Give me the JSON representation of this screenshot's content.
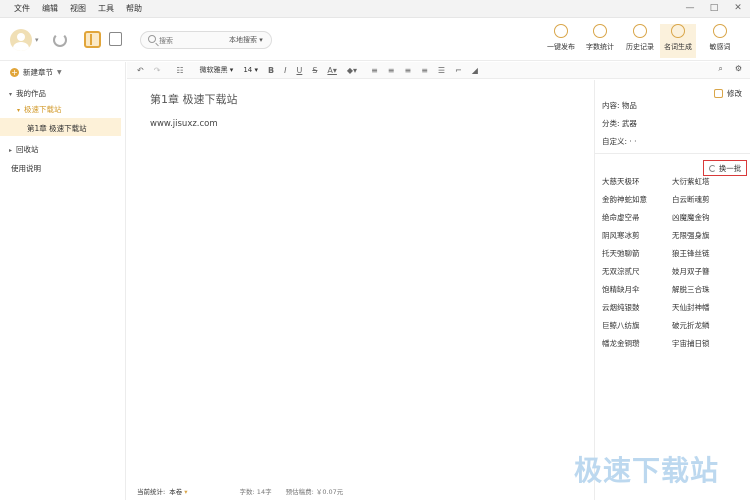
{
  "menu": [
    "文件",
    "编辑",
    "视图",
    "工具",
    "帮助"
  ],
  "window_controls": [
    "—",
    "□",
    "✕"
  ],
  "search": {
    "placeholder": "搜索",
    "scope": "本地搜索"
  },
  "toolbar": {
    "buttons": [
      {
        "label": "一键发布",
        "icon": "paper-plane-icon"
      },
      {
        "label": "字数统计",
        "icon": "stats-icon"
      },
      {
        "label": "历史记录",
        "icon": "history-icon"
      },
      {
        "label": "名词生成",
        "icon": "name-generator-icon",
        "active": true
      },
      {
        "label": "敏感词",
        "icon": "sensitive-word-icon"
      }
    ]
  },
  "sidebar": {
    "new_chapter": "新建章节",
    "my_works": "我的作品",
    "book": "极速下载站",
    "chapter": "第1章 极速下载站",
    "recycle": "回收站",
    "help": "使用说明"
  },
  "edit_toolbar": {
    "font": "微软雅黑",
    "size": "14"
  },
  "editor": {
    "chapter_title": "第1章  极速下载站",
    "body": "www.jisuxz.com"
  },
  "status": {
    "label": "当前统计:",
    "scope": "本卷",
    "words": "字数:  14字",
    "earnings": "预估稿费:  ￥0.07元"
  },
  "right_panel": {
    "edit": "修改",
    "content": "内容: 物品",
    "category": "分类: 武器",
    "custom": "自定义: · ·",
    "refresh": "换一批",
    "names": [
      "大慈天极环",
      "大衍紫虹塔",
      "金韵神蛇如意",
      "白云断魂剪",
      "绝命虚空帚",
      "凶魔魔金钩",
      "阴风寒冰剪",
      "无限强身旗",
      "托天弛聊箭",
      "狼王锋丝链",
      "无双淙贰尺",
      "妓月双子簪",
      "饱精缺月伞",
      "解脱三合珠",
      "云烟纯银鼓",
      "天仙封神幡",
      "巨鲸八纺旗",
      "破元折龙鳞",
      "幡龙金铜瓒",
      "宇宙捕日锁"
    ]
  },
  "watermark": "极速下载站",
  "colors": {
    "accent": "#e1a53a",
    "highlight": "#fdf1d8",
    "alert": "#d93a3a"
  }
}
